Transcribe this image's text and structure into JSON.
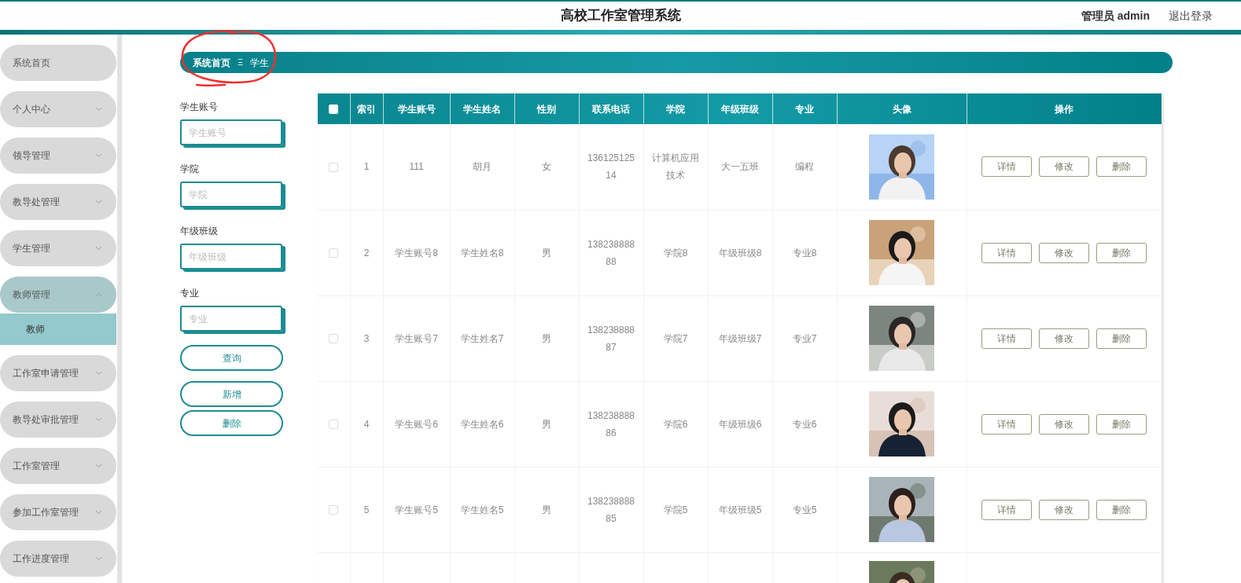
{
  "header": {
    "title": "高校工作室管理系统",
    "user": "管理员 admin",
    "logout": "退出登录"
  },
  "sidebar": {
    "items": [
      {
        "label": "系统首页",
        "kind": "link",
        "expanded": false
      },
      {
        "label": "个人中心",
        "kind": "menu",
        "expanded": false
      },
      {
        "label": "领导管理",
        "kind": "menu",
        "expanded": false
      },
      {
        "label": "教导处管理",
        "kind": "menu",
        "expanded": false
      },
      {
        "label": "学生管理",
        "kind": "menu",
        "expanded": false
      },
      {
        "label": "教师管理",
        "kind": "menu",
        "expanded": true,
        "children": [
          {
            "label": "教师",
            "selected": true
          }
        ]
      },
      {
        "label": "工作室申请管理",
        "kind": "menu",
        "expanded": false
      },
      {
        "label": "教导处审批管理",
        "kind": "menu",
        "expanded": false
      },
      {
        "label": "工作室管理",
        "kind": "menu",
        "expanded": false
      },
      {
        "label": "参加工作室管理",
        "kind": "menu",
        "expanded": false
      },
      {
        "label": "工作进度管理",
        "kind": "menu",
        "expanded": false
      }
    ]
  },
  "breadcrumb": {
    "home": "系统首页",
    "separator": "Ξ",
    "current": "学生"
  },
  "search": {
    "fields": [
      {
        "label": "学生账号",
        "placeholder": "学生账号"
      },
      {
        "label": "学院",
        "placeholder": "学院"
      },
      {
        "label": "年级班级",
        "placeholder": "年级班级"
      },
      {
        "label": "专业",
        "placeholder": "专业"
      }
    ],
    "buttons": [
      "查询",
      "新增",
      "删除"
    ]
  },
  "table": {
    "select_all": {
      "checked": false
    },
    "columns": [
      "索引",
      "学生账号",
      "学生姓名",
      "性别",
      "联系电话",
      "学院",
      "年级班级",
      "专业",
      "头像",
      "操作"
    ],
    "rows": [
      {
        "checked": false,
        "cells": [
          "1",
          "111",
          "胡月",
          "女",
          "13612512514",
          "计算机应用技术",
          "大一五班",
          "编程"
        ],
        "avatar": {
          "kind": "picture"
        },
        "actions": [
          "详情",
          "修改",
          "删除"
        ]
      },
      {
        "checked": false,
        "cells": [
          "2",
          "学生账号8",
          "学生姓名8",
          "男",
          "13823888888",
          "学院8",
          "年级班级8",
          "专业8"
        ],
        "avatar": {
          "kind": "picture"
        },
        "actions": [
          "详情",
          "修改",
          "删除"
        ]
      },
      {
        "checked": false,
        "cells": [
          "3",
          "学生账号7",
          "学生姓名7",
          "男",
          "13823888887",
          "学院7",
          "年级班级7",
          "专业7"
        ],
        "avatar": {
          "kind": "picture"
        },
        "actions": [
          "详情",
          "修改",
          "删除"
        ]
      },
      {
        "checked": false,
        "cells": [
          "4",
          "学生账号6",
          "学生姓名6",
          "男",
          "13823888886",
          "学院6",
          "年级班级6",
          "专业6"
        ],
        "avatar": {
          "kind": "picture"
        },
        "actions": [
          "详情",
          "修改",
          "删除"
        ]
      },
      {
        "checked": false,
        "cells": [
          "5",
          "学生账号5",
          "学生姓名5",
          "男",
          "13823888885",
          "学院5",
          "年级班级5",
          "专业5"
        ],
        "avatar": {
          "kind": "picture"
        },
        "actions": [
          "详情",
          "修改",
          "删除"
        ]
      },
      {
        "avatar": {
          "kind": "picture"
        }
      }
    ]
  }
}
